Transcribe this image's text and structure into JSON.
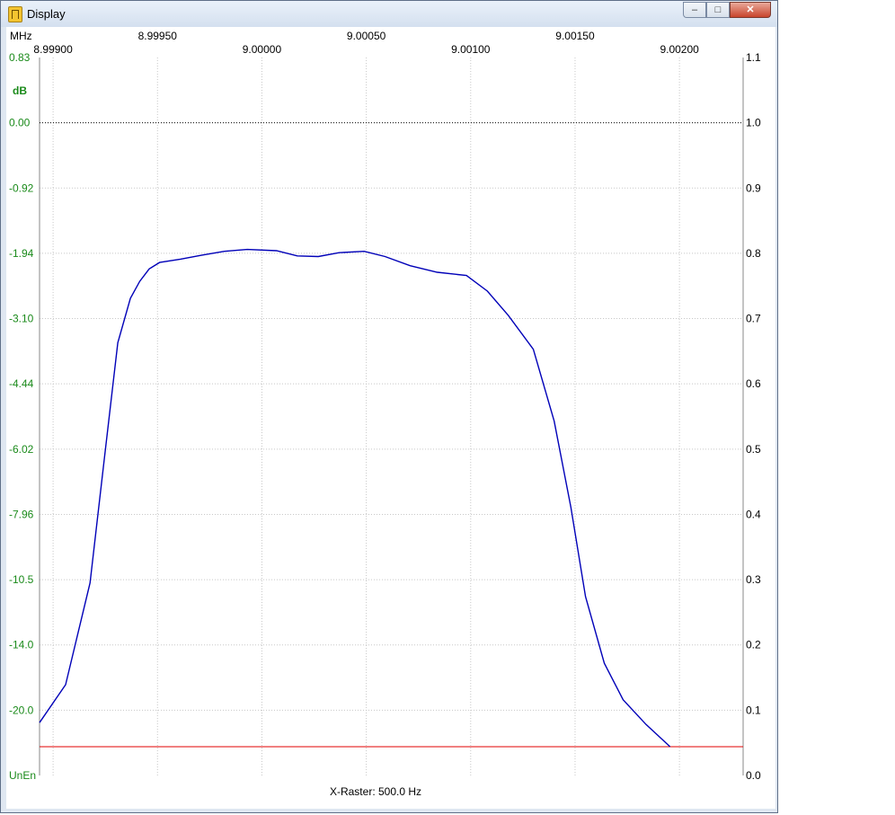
{
  "window": {
    "title": "Display",
    "buttons": {
      "minimize": "–",
      "maximize": "□",
      "close": "✕"
    }
  },
  "colors": {
    "trace": "#0000b8",
    "reference_line": "#e00000",
    "left_axis_text": "#1a8a1a",
    "grid": "#c8c8c8"
  },
  "chart_data": {
    "type": "line",
    "x_unit": "MHz",
    "xlim": [
      8.998935,
      9.002305
    ],
    "x_ticks_top_row": [
      "8.99950",
      "9.00050",
      "9.00150"
    ],
    "x_ticks_bottom_row": [
      "8.99900",
      "9.00000",
      "9.00100",
      "9.00200"
    ],
    "x_tick_values": [
      8.999,
      8.9995,
      9.0,
      9.0005,
      9.001,
      9.0015,
      9.002
    ],
    "left_axis": {
      "unit": "dB",
      "tick_labels": [
        "0.83",
        "0.00",
        "-0.92",
        "-1.94",
        "-3.10",
        "-4.44",
        "-6.02",
        "-7.96",
        "-10.5",
        "-14.0",
        "-20.0",
        "UnEn"
      ]
    },
    "right_axis": {
      "ylim": [
        0.0,
        1.1
      ],
      "tick_labels": [
        "1.1",
        "1.0",
        "0.9",
        "0.8",
        "0.7",
        "0.6",
        "0.5",
        "0.4",
        "0.3",
        "0.2",
        "0.1",
        "0.0"
      ],
      "tick_values": [
        1.1,
        1.0,
        0.9,
        0.8,
        0.7,
        0.6,
        0.5,
        0.4,
        0.3,
        0.2,
        0.1,
        0.0
      ]
    },
    "reference_value": 1.0,
    "cutoff_value": 0.044,
    "footer": "X-Raster: 500.0 Hz",
    "grid": true,
    "series": [
      {
        "x": [
          8.998935,
          8.99906,
          8.999177,
          8.99924,
          8.99931,
          8.99937,
          8.999415,
          8.99946,
          8.99951,
          8.99961,
          8.99971,
          8.99982,
          8.99993,
          9.00007,
          9.00017,
          9.00027,
          9.00037,
          9.00049,
          9.00059,
          9.00071,
          9.00084,
          9.00098,
          9.00108,
          9.00118,
          9.0013,
          9.0014,
          9.00148,
          9.00155,
          9.00164,
          9.00173,
          9.00184,
          9.001955
        ],
        "y": [
          0.081,
          0.139,
          0.295,
          0.471,
          0.663,
          0.731,
          0.757,
          0.776,
          0.786,
          0.791,
          0.797,
          0.803,
          0.806,
          0.804,
          0.796,
          0.795,
          0.801,
          0.803,
          0.795,
          0.781,
          0.771,
          0.766,
          0.742,
          0.705,
          0.653,
          0.543,
          0.411,
          0.274,
          0.172,
          0.116,
          0.078,
          0.044
        ]
      }
    ]
  }
}
